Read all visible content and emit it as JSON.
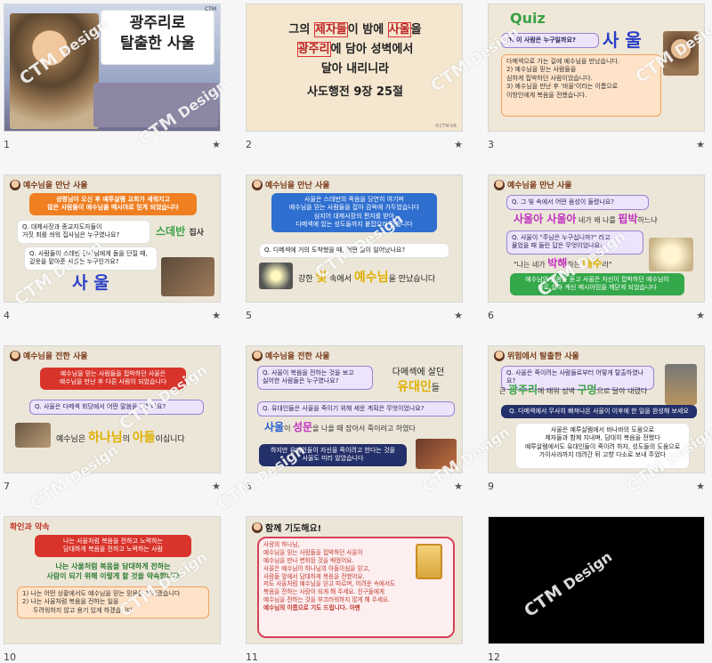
{
  "watermark": {
    "brand": "CTM",
    "text": "Design"
  },
  "slides": [
    {
      "num": "1",
      "title_line1": "광주리로",
      "title_line2": "탈출한 사울",
      "tag": "CTM"
    },
    {
      "num": "2",
      "line1a": "그의 ",
      "line1b": "제자들",
      "line1c": "이 밤에 ",
      "line1d": "사울",
      "line1e": "을",
      "line2a": "광주리",
      "line2b": "에 담아 성벽에서",
      "line3": "달아 내리니라",
      "ref": "사도행전 9장 25절",
      "mark": "©CTM KR"
    },
    {
      "num": "3",
      "quiz": "Quiz",
      "q": "Q. 이 사람은 누구일까요?",
      "answer": "사 울",
      "hint1": "1) 예수님을 믿는 사람들을",
      "hint1b": "다메섹으로 가는 길에 예수님을 만났습니다.",
      "hint2": "2) 예수님을 믿는 사람들을",
      "hint2b": "심하게 핍박하던 사람이었습니다.",
      "hint3": "3) 예수님을 만난 후 '바울'이라는 이름으로",
      "hint3b": "이방인에게 복음을 전했습니다."
    },
    {
      "num": "4",
      "hdr": "예수님을 만난 사울",
      "box1": "성령님이 오신 후 예루살렘 교회가 세워지고",
      "box1b": "많은 사람들이 예수님을 메시아로 믿게 되었습니다",
      "q1": "Q. 대제사장과 종교지도자들이",
      "q1b": "거짓 죄를 씌워 집사님은 누구였나요?",
      "a1": "스데반",
      "a1b": "집사",
      "q2": "Q. 사람들이 스데반 집사님에게 돌을 던질 때,",
      "q2b": "겉옷을 맡아준 사람은 누구인가요?",
      "a2": "사 울"
    },
    {
      "num": "5",
      "hdr": "예수님을 만난 사울",
      "box1": "사울은 스데반의 죽음을 당연히 여기며",
      "box1b": "예수님을 믿는 사람들을 잡아 감옥에 가두었습니다",
      "box1c": "심지어 대제사장의 편지를 받아",
      "box1d": "다메섹에 있는 성도들까지 붙잡으러 갔습니다",
      "q": "Q. 다메섹에 거의 도착했을 때, 어떤 일이 일어났나요?",
      "a1": "강한",
      "a2": "빛",
      "a3": "속에서",
      "a4": "예수님",
      "a5": "을 만났습니다"
    },
    {
      "num": "6",
      "hdr": "예수님을 만난 사울",
      "q1": "Q. 그 빛 속에서 어떤 음성이 들렸나요?",
      "a1a": "사울아 사울아",
      "a1b": "네가 왜 나를",
      "a1c": "핍박",
      "a1d": "하느냐",
      "q2": "Q. 사울이 \"주님은 누구십니까?\" 라고",
      "q2b": "물었을 때 들린 답은 무엇이었나요?",
      "a2a": "\"나는 네가",
      "a2b": "박해",
      "a2c": "하는",
      "a2d": "예수",
      "a2e": "라\"",
      "box": "예수님의 말씀을 듣고 사울은 자신이 핍박하던 예수님이",
      "boxb": "바로 살아 계신 메시아임을 깨닫게 되었습니다"
    },
    {
      "num": "7",
      "hdr": "예수님을 전한 사울",
      "box1": "예수님을 믿는 사람들을 핍박하던 사울은",
      "box1b": "예수님을 만난 후 다른 사람이 되었습니다",
      "q": "Q. 사울은 다메섹 회당에서 어떤 말씀을 전했나요?",
      "a1": "예수님은",
      "a2": "하나님",
      "a3": "의",
      "a4": "아들",
      "a5": "이십니다"
    },
    {
      "num": "8",
      "hdr": "예수님을 전한 사울",
      "q1": "Q. 사울이 복음을 전하는 것을 보고",
      "q1b": "싫어한 사람들은 누구였나요?",
      "a1": "다메섹에 살던",
      "a1b": "유대인",
      "a1c": "들",
      "q2": "Q. 유대인들은 사울을 죽이기 위해 세운 계획은 무엇이었나요?",
      "a2a": "사울",
      "a2b": "이",
      "a2c": "성문",
      "a2d": "을 나올 때 잡아서 죽이려고 하였다",
      "box": "하지만 유대인들이 자신을 죽이려고 한다는 것을",
      "boxb": "사울도 미리 알았습니다"
    },
    {
      "num": "9",
      "hdr": "위험에서 탈출한 사울",
      "q1": "Q. 사울은 죽이려는 사람들로부터 어떻게 탈출하였나요?",
      "a1a": "큰",
      "a1b": "광주리",
      "a1c": "에 태워 성벽",
      "a1d": "구멍",
      "a1e": "으로 달아 내렸다",
      "q2": "Q. 다메섹에서 무사히 빠져나온 사울이 이후에 한 일을 완성해 보세요",
      "p1": "사울은 예루살렘에서 바나바의 도움으로",
      "p2": "제자들과 함께 지내며, 담대히 복음을 전했다",
      "p3": "예루살렘에서도 유대인들이 죽이려 하자, 성도들의 도움으로",
      "p4": "가이사랴까지 데려간 뒤 고향 다소로 보내 주었다"
    },
    {
      "num": "10",
      "hdr": "확인과 약속",
      "box1": "나는 사울처럼 복음을 전하고 노력하는",
      "box1b": "담대하게 복음을 전하고 노력하는 사람",
      "box2": "나는 사울처럼 복음을 담대하게 전하는",
      "box2b": "사람이 되기 위해 이렇게 할 것을 약속합니다",
      "p1": "1) 나는 어떤 상황에서도 예수님을 믿는 믿음을 지키겠습니다",
      "p2": "2) 나는 사울처럼 복음을 전하는 일을",
      "p2b": "두려워하지 않고 용기 있게 하겠습니다"
    },
    {
      "num": "11",
      "hdr": "함께 기도해요!",
      "l1": "사랑의 하나님,",
      "l2": "예수님을 믿는 사람들을 핍박하던 사울이",
      "l3": "예수님을 만나 변화된 것을 배웠어요.",
      "l4": "사울은 예수님이 하나님의 아들이심을 믿고,",
      "l5": "사람들 앞에서 담대하게 복음을 전했어요.",
      "l6": "저도 사울처럼 예수님을 믿고 따르며, 어려운 속에서도",
      "l7": "복음을 전하는 사람이 되게 해 주세요. 친구들에게",
      "l8": "예수님을 전하는 것을 부끄러워하지 않게 해 주세요.",
      "l9": "예수님의 이름으로 기도 드립니다. 아멘"
    },
    {
      "num": "12"
    }
  ]
}
